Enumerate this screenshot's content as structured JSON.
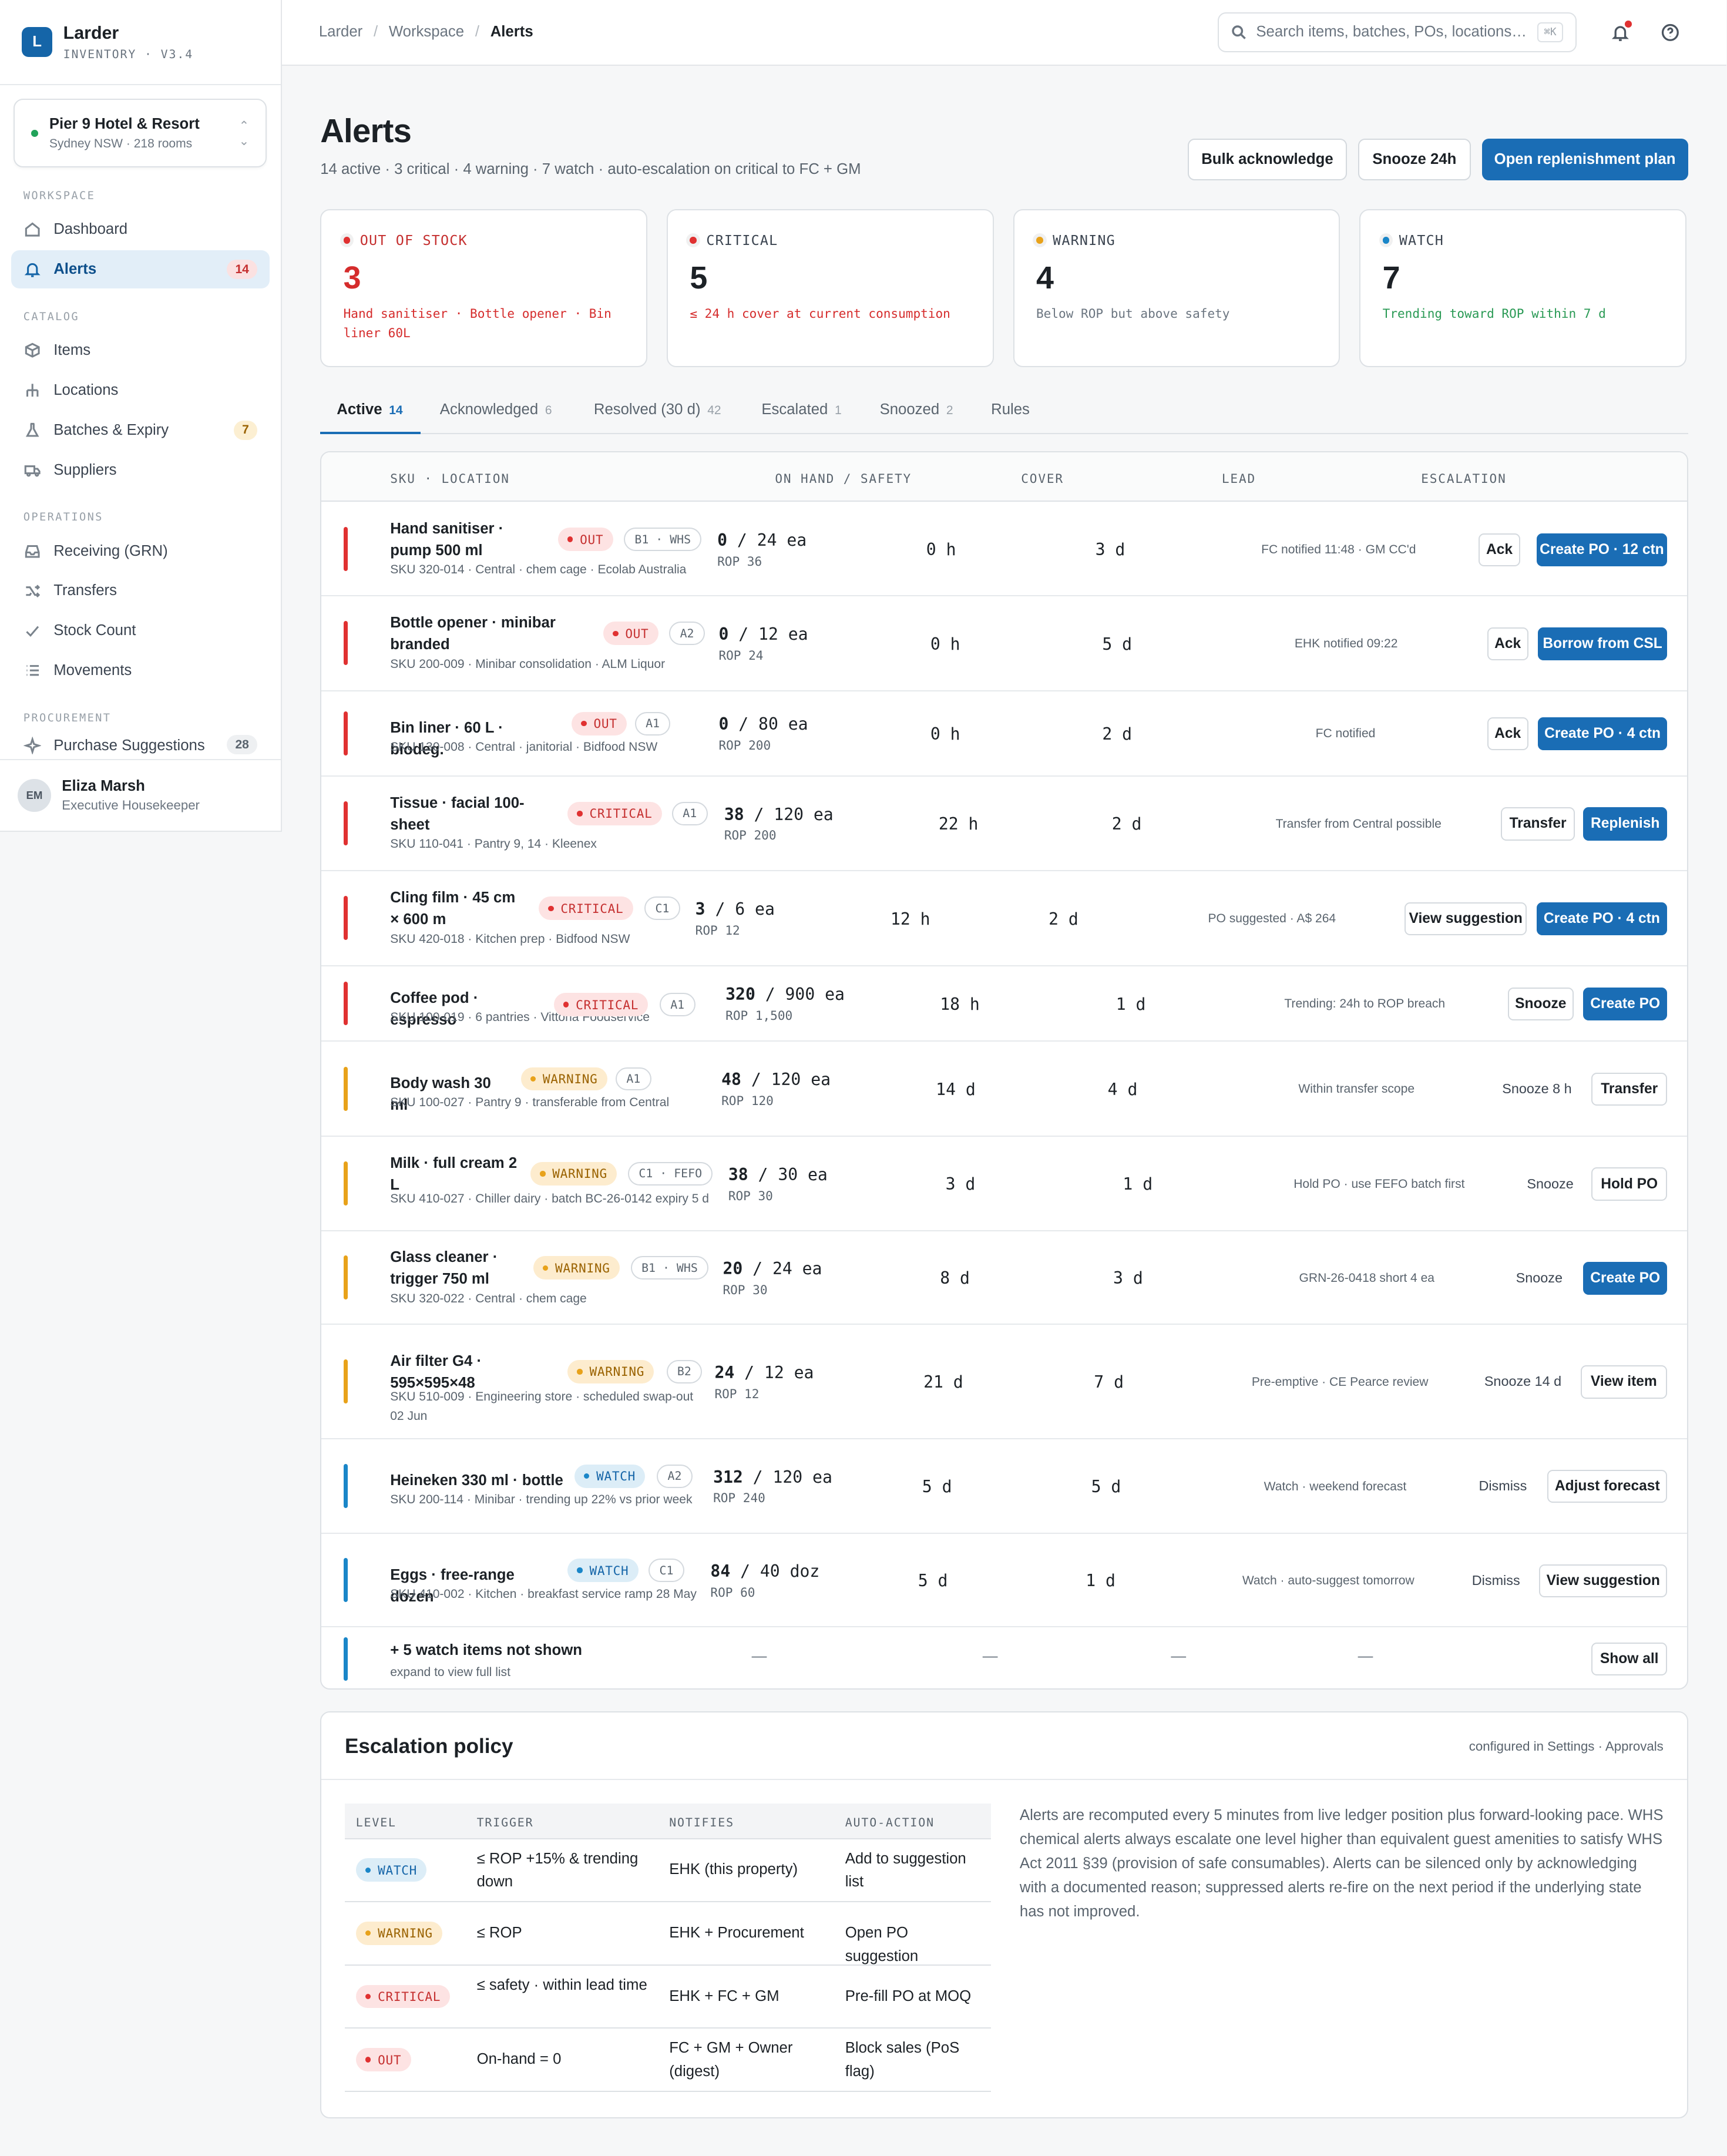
{
  "app": {
    "name": "Larder",
    "version": "INVENTORY · V3.4",
    "logo": "L"
  },
  "property": {
    "name": "Pier 9 Hotel & Resort",
    "sub": "Sydney NSW · 218 rooms"
  },
  "sidebar": {
    "workspace_label": "WORKSPACE",
    "catalog_label": "CATALOG",
    "operations_label": "OPERATIONS",
    "procurement_label": "PROCUREMENT",
    "dashboard": "Dashboard",
    "alerts": "Alerts",
    "alerts_count": "14",
    "items": "Items",
    "locations": "Locations",
    "batches": "Batches & Expiry",
    "batches_count": "7",
    "suppliers": "Suppliers",
    "receiving": "Receiving (GRN)",
    "transfers": "Transfers",
    "stock_count": "Stock Count",
    "movements": "Movements",
    "purchase": "Purchase Suggestions",
    "purchase_count": "28"
  },
  "user": {
    "initials": "EM",
    "name": "Eliza Marsh",
    "role": "Executive Housekeeper"
  },
  "breadcrumb": {
    "a": "Larder",
    "b": "Workspace",
    "c": "Alerts"
  },
  "search": {
    "placeholder": "Search items, batches, POs, locations…",
    "kbd": "⌘K"
  },
  "page": {
    "title": "Alerts",
    "subtitle": "14 active · 3 critical · 4 warning · 7 watch · auto-escalation on critical to FC + GM"
  },
  "actions": {
    "bulk": "Bulk acknowledge",
    "snooze": "Snooze 24h",
    "open": "Open replenishment plan"
  },
  "kpis": [
    {
      "label": "OUT OF STOCK",
      "value": "3",
      "desc": "Hand sanitiser · Bottle opener · Bin liner 60L",
      "color": "#e03131"
    },
    {
      "label": "CRITICAL",
      "value": "5",
      "desc": "≤ 24 h cover at current consumption",
      "color": "#e03131"
    },
    {
      "label": "WARNING",
      "value": "4",
      "desc": "Below ROP but above safety",
      "color": "#e8a21a"
    },
    {
      "label": "WATCH",
      "value": "7",
      "desc": "Trending toward ROP within 7 d",
      "color": "#1a86c8"
    }
  ],
  "tabs": [
    {
      "label": "Active",
      "count": "14"
    },
    {
      "label": "Acknowledged",
      "count": "6"
    },
    {
      "label": "Resolved (30 d)",
      "count": "42"
    },
    {
      "label": "Escalated",
      "count": "1"
    },
    {
      "label": "Snoozed",
      "count": "2"
    },
    {
      "label": "Rules",
      "count": ""
    }
  ],
  "table": {
    "headers": {
      "sku": "SKU · LOCATION",
      "onhand": "ON HAND / SAFETY",
      "cover": "COVER",
      "lead": "LEAD",
      "escalation": "ESCALATION"
    },
    "rows": [
      {
        "name": "Hand sanitiser · pump 500 ml",
        "sub": "SKU 320-014 · Central · chem cage · Ecolab Australia",
        "status": "OUT",
        "loc": "B1 · WHS",
        "onhand": "0",
        "safety": "24 ea",
        "rop": "ROP 36",
        "cover": "0 h",
        "lead": "3 d",
        "esc": "FC notified 11:48 · GM CC'd",
        "b1": "Ack",
        "b2": "Create PO · 12 ctn"
      },
      {
        "name": "Bottle opener · minibar branded",
        "sub": "SKU 200-009 · Minibar consolidation · ALM Liquor",
        "status": "OUT",
        "loc": "A2",
        "onhand": "0",
        "safety": "12 ea",
        "rop": "ROP 24",
        "cover": "0 h",
        "lead": "5 d",
        "esc": "EHK notified 09:22",
        "b1": "Ack",
        "b2": "Borrow from CSL"
      },
      {
        "name": "Bin liner · 60 L · biodeg.",
        "sub": "SKU 130-008 · Central · janitorial · Bidfood NSW",
        "status": "OUT",
        "loc": "A1",
        "onhand": "0",
        "safety": "80 ea",
        "rop": "ROP 200",
        "cover": "0 h",
        "lead": "2 d",
        "esc": "FC notified",
        "b1": "Ack",
        "b2": "Create PO · 4 ctn"
      },
      {
        "name": "Tissue · facial 100-sheet",
        "sub": "SKU 110-041 · Pantry 9, 14 · Kleenex",
        "status": "CRITICAL",
        "loc": "A1",
        "onhand": "38",
        "safety": "120 ea",
        "rop": "ROP 200",
        "cover": "22 h",
        "lead": "2 d",
        "esc": "Transfer from Central possible",
        "b1": "Transfer",
        "b2": "Replenish"
      },
      {
        "name": "Cling film · 45 cm × 600 m",
        "sub": "SKU 420-018 · Kitchen prep · Bidfood NSW",
        "status": "CRITICAL",
        "loc": "C1",
        "onhand": "3",
        "safety": "6 ea",
        "rop": "ROP 12",
        "cover": "12 h",
        "lead": "2 d",
        "esc": "PO suggested · A$ 264",
        "b1": "View suggestion",
        "b2": "Create PO · 4 ctn"
      },
      {
        "name": "Coffee pod · espresso",
        "sub": "SKU 100-019 · 6 pantries · Vittoria Foodservice",
        "status": "CRITICAL",
        "loc": "A1",
        "onhand": "320",
        "safety": "900 ea",
        "rop": "ROP 1,500",
        "cover": "18 h",
        "lead": "1 d",
        "esc": "Trending: 24h to ROP breach",
        "b1": "Snooze",
        "b2": "Create PO"
      },
      {
        "name": "Body wash 30 ml",
        "sub": "SKU 100-027 · Pantry 9 · transferable from Central",
        "status": "WARNING",
        "loc": "A1",
        "onhand": "48",
        "safety": "120 ea",
        "rop": "ROP 120",
        "cover": "14 d",
        "lead": "4 d",
        "esc": "Within transfer scope",
        "b1": "Snooze 8 h",
        "b2": "Transfer"
      },
      {
        "name": "Milk · full cream 2 L",
        "sub": "SKU 410-027 · Chiller dairy · batch BC-26-0142 expiry 5 d",
        "status": "WARNING",
        "loc": "C1 · FEFO",
        "onhand": "38",
        "safety": "30 ea",
        "rop": "ROP 30",
        "cover": "3 d",
        "lead": "1 d",
        "esc": "Hold PO · use FEFO batch first",
        "b1": "Snooze",
        "b2": "Hold PO"
      },
      {
        "name": "Glass cleaner · trigger 750 ml",
        "sub": "SKU 320-022 · Central · chem cage",
        "status": "WARNING",
        "loc": "B1 · WHS",
        "onhand": "20",
        "safety": "24 ea",
        "rop": "ROP 30",
        "cover": "8 d",
        "lead": "3 d",
        "esc": "GRN-26-0418 short 4 ea",
        "b1": "Snooze",
        "b2": "Create PO"
      },
      {
        "name": "Air filter G4 · 595×595×48",
        "sub": "SKU 510-009 · Engineering store · scheduled swap-out 02 Jun",
        "status": "WARNING",
        "loc": "B2",
        "onhand": "24",
        "safety": "12 ea",
        "rop": "ROP 12",
        "cover": "21 d",
        "lead": "7 d",
        "esc": "Pre-emptive · CE Pearce review",
        "b1": "Snooze 14 d",
        "b2": "View item"
      },
      {
        "name": "Heineken 330 ml · bottle",
        "sub": "SKU 200-114 · Minibar · trending up 22% vs prior week",
        "status": "WATCH",
        "loc": "A2",
        "onhand": "312",
        "safety": "120 ea",
        "rop": "ROP 240",
        "cover": "5 d",
        "lead": "5 d",
        "esc": "Watch · weekend forecast",
        "b1": "Dismiss",
        "b2": "Adjust forecast"
      },
      {
        "name": "Eggs · free-range dozen",
        "sub": "SKU 410-002 · Kitchen · breakfast service ramp 28 May",
        "status": "WATCH",
        "loc": "C1",
        "onhand": "84",
        "safety": "40 doz",
        "rop": "ROP 60",
        "cover": "5 d",
        "lead": "1 d",
        "esc": "Watch · auto-suggest tomorrow",
        "b1": "Dismiss",
        "b2": "View suggestion"
      }
    ],
    "more": {
      "title": "+ 5 watch items not shown",
      "sub": "expand to view full list",
      "dash": "—",
      "button": "Show all"
    }
  },
  "policy": {
    "title": "Escalation policy",
    "configured": "configured in Settings · Approvals",
    "headers": {
      "level": "LEVEL",
      "trigger": "TRIGGER",
      "notifies": "NOTIFIES",
      "action": "AUTO-ACTION"
    },
    "rows": [
      {
        "level": "WATCH",
        "trigger": "≤ ROP +15% & trending down",
        "notifies": "EHK (this property)",
        "action": "Add to suggestion list"
      },
      {
        "level": "WARNING",
        "trigger": "≤ ROP",
        "notifies": "EHK + Procurement",
        "action": "Open PO suggestion"
      },
      {
        "level": "CRITICAL",
        "trigger": "≤ safety · within lead time",
        "notifies": "EHK + FC + GM",
        "action": "Pre-fill PO at MOQ"
      },
      {
        "level": "OUT",
        "trigger": "On-hand = 0",
        "notifies": "FC + GM + Owner (digest)",
        "action": "Block sales (PoS flag)"
      }
    ],
    "note": "Alerts are recomputed every 5 minutes from live ledger position plus forward-looking pace. WHS chemical alerts always escalate one level higher than equivalent guest amenities to satisfy WHS Act 2011 §39 (provision of safe consumables). Alerts can be silenced only by acknowledging with a documented reason; suppressed alerts re-fire on the next period if the underlying state has not improved."
  },
  "colors": {
    "accent": "#1a6db5",
    "out": "#e03131",
    "warning": "#e8a21a",
    "watch": "#1a86c8"
  }
}
